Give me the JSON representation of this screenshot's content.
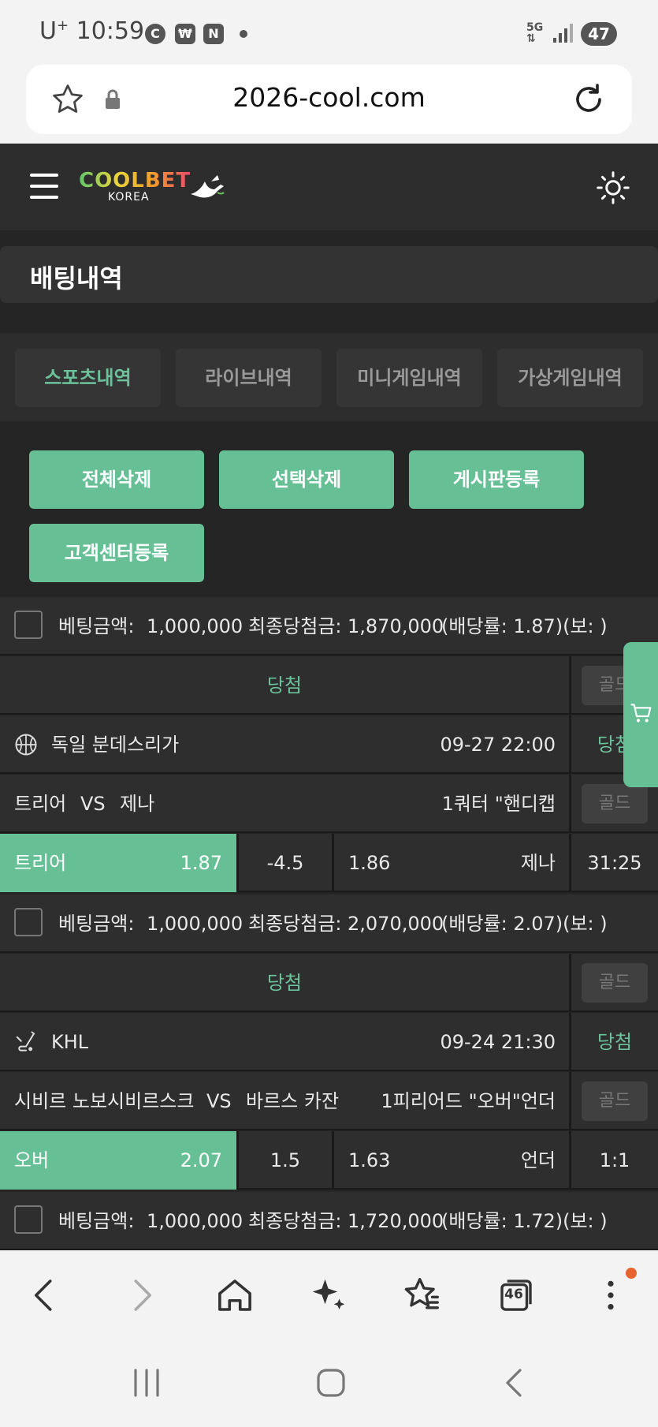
{
  "status_bar": {
    "carrier": "U",
    "carrier_sup": "+",
    "time": "10:59",
    "icon1": "C",
    "icon3": "N",
    "network": "5G",
    "battery": "47"
  },
  "browser": {
    "url": "2026-cool.com",
    "tabs_count": "46"
  },
  "site": {
    "logo_main": "COOLBET",
    "logo_sub": "KOREA",
    "page_title": "배팅내역",
    "tabs": [
      "스포츠내역",
      "라이브내역",
      "미니게임내역",
      "가상게임내역"
    ],
    "actions": [
      "전체삭제",
      "선택삭제",
      "게시판등록",
      "고객센터등록"
    ]
  },
  "bets": [
    {
      "summary_label_amount": "베팅금액:",
      "amount": "1,000,000",
      "summary_label_payout": "최종당첨금:",
      "payout": "1,870,000",
      "odds_text": "(배당률: 1.87)(보: )",
      "result": "당첨",
      "gold": "골드",
      "league": "독일 분데스리가",
      "datetime": "09-27 22:00",
      "status": "당첨",
      "home": "트리어",
      "vs": "VS",
      "away": "제나",
      "market": "1쿼터 \"핸디캡",
      "gold2": "골드",
      "pick": "트리어",
      "pick_odds": "1.87",
      "line": "-4.5",
      "other_odds": "1.86",
      "other": "제나",
      "score": "31:25"
    },
    {
      "summary_label_amount": "베팅금액:",
      "amount": "1,000,000",
      "summary_label_payout": "최종당첨금:",
      "payout": "2,070,000",
      "odds_text": "(배당률: 2.07)(보: )",
      "result": "당첨",
      "gold": "골드",
      "league": "KHL",
      "datetime": "09-24 21:30",
      "status": "당첨",
      "home": "시비르 노보시비르스크",
      "vs": "VS",
      "away": "바르스 카잔",
      "market": "1피리어드 \"오버\"언더",
      "gold2": "골드",
      "pick": "오버",
      "pick_odds": "2.07",
      "line": "1.5",
      "other_odds": "1.63",
      "other": "언더",
      "score": "1:1"
    },
    {
      "summary_label_amount": "베팅금액:",
      "amount": "1,000,000",
      "summary_label_payout": "최종당첨금:",
      "payout": "1,720,000",
      "odds_text": "(배당률: 1.72)(보: )"
    }
  ],
  "colors": {
    "accent": "#67bf96",
    "background": "#252525",
    "panel": "#2e2e2e"
  }
}
